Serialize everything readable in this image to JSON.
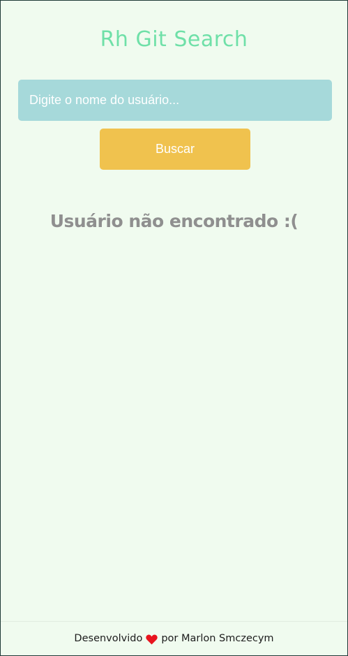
{
  "app": {
    "title": "Rh Git Search"
  },
  "search": {
    "placeholder": "Digite o nome do usuário...",
    "value": "",
    "button_label": "Buscar"
  },
  "result": {
    "message": "Usuário não encontrado :("
  },
  "footer": {
    "prefix": "Desenvolvido",
    "icon": "heart-icon",
    "suffix": "por Marlon Smczecym"
  },
  "colors": {
    "background": "#f0fbef",
    "title": "#6fe0a8",
    "input_background": "#a6d9da",
    "button_background": "#f0c24e",
    "message": "#8f8f8f",
    "heart": "#e8141e"
  }
}
